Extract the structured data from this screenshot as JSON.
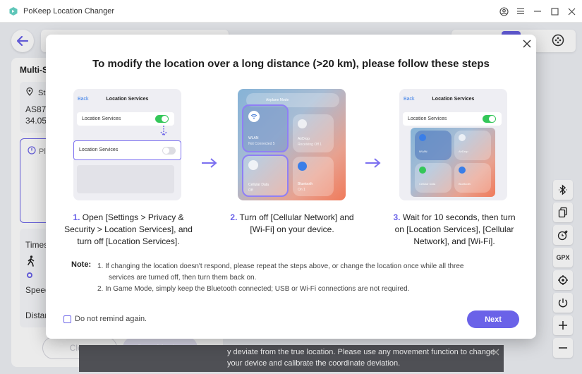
{
  "app": {
    "title": "PoKeep Location Changer",
    "brand_color": "#5fc6b9",
    "accent": "#6a62e8"
  },
  "background": {
    "panel_title": "Multi-S",
    "start_label": "St",
    "coord_line1": "AS879",
    "coord_line2": "34.05",
    "plan_label": "Pl",
    "times_label": "Times",
    "speed_label": "Speed",
    "distance_label": "Distan",
    "clear_label": "Clear",
    "start_moving_label": "Start Moving",
    "toast_line1": "y deviate from the true location. Please use any movement function to change",
    "toast_line2": "your device and calibrate the coordinate deviation.",
    "gpx_label": "GPX"
  },
  "modal": {
    "title": "To modify the location over a long distance (>20 km), please follow these steps",
    "steps": [
      {
        "num": "1.",
        "lines": [
          "Open [Settings > Privacy &",
          "Security > Location Services], and",
          "turn off [Location Services]."
        ],
        "illustration": {
          "back": "Back",
          "title": "Location Services",
          "row_on": "Location Services",
          "row_off": "Location Services"
        }
      },
      {
        "num": "2.",
        "lines": [
          "Turn off [Cellular Network] and",
          "[Wi-Fi] on your device."
        ],
        "illustration": {
          "airplane": "Airplane Mode",
          "wlan": "WLAN",
          "wlan_sub": "Not Connected 5",
          "airdrop": "AirDrop",
          "airdrop_sub": "Receiving Off 1",
          "cellular": "Cellular Data",
          "cellular_sub": "Off",
          "bluetooth": "Bluetooth",
          "bluetooth_sub": "On 1"
        }
      },
      {
        "num": "3.",
        "lines": [
          "Wait for 10 seconds, then turn",
          "on [Location Services], [Cellular",
          "Network], and [Wi-Fi]."
        ],
        "illustration": {
          "back": "Back",
          "title": "Location Services",
          "row_on": "Location Services",
          "wlan": "WLAN",
          "airdrop": "AirDrop",
          "cellular": "Cellular Data",
          "bluetooth": "Bluetooth"
        }
      }
    ],
    "note_label": "Note:",
    "note_lines": [
      "1. If changing the location doesn't respond, please repeat the steps above, or change the location once while all three",
      "services are turned off, then turn them back on.",
      "2. In Game Mode, simply keep the Bluetooth connected; USB or Wi-Fi connections are not required."
    ],
    "remind_label": "Do not remind again.",
    "next_label": "Next"
  }
}
